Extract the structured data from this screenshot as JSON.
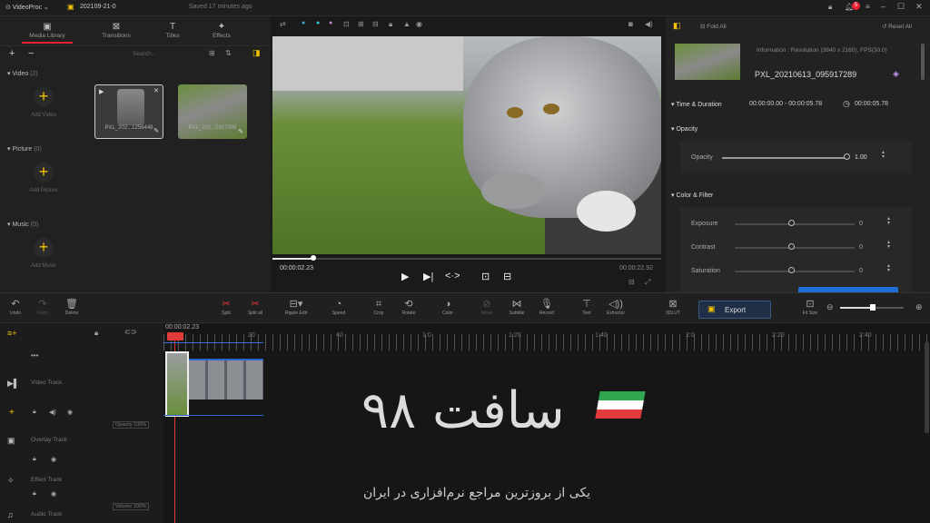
{
  "app": {
    "name": "VideoProc",
    "project": "202109-21-0",
    "saved": "Saved 17 minutes ago",
    "notif_count": "5"
  },
  "left_tabs": [
    {
      "label": "Media Library",
      "icon": "media-icon"
    },
    {
      "label": "Transitions",
      "icon": "transitions-icon"
    },
    {
      "label": "Titles",
      "icon": "titles-icon"
    },
    {
      "label": "Effects",
      "icon": "effects-icon"
    }
  ],
  "search": {
    "placeholder": "Search..."
  },
  "video_section": {
    "title": "Video",
    "count": "(2)",
    "add_label": "Add Video",
    "items": [
      {
        "name": "PXL_202...1256448"
      },
      {
        "name": "PXL_202...5917289"
      }
    ]
  },
  "picture_section": {
    "title": "Picture",
    "count": "(0)",
    "add_label": "Add Picture"
  },
  "music_section": {
    "title": "Music",
    "count": "(0)",
    "add_label": "Add Music"
  },
  "preview": {
    "current_time": "00:00:02.23",
    "total_time": "00:00:22.92"
  },
  "right": {
    "fold_all": "Fold All",
    "reset_all": "Reset All",
    "info": "Information : Resolution (3840 x 2160), FPS(30.0)",
    "clip_name": "PXL_20210613_095917289",
    "time_duration": {
      "title": "Time & Duration",
      "range": "00:00:00.00 - 00:00:05.78",
      "duration": "00:00:05.78"
    },
    "opacity": {
      "title": "Opacity",
      "label": "Opacity",
      "value": "1.00",
      "level": 1.0
    },
    "color_filter": {
      "title": "Color & Filter",
      "rows": [
        {
          "label": "Exposure",
          "value": "0"
        },
        {
          "label": "Contrast",
          "value": "0"
        },
        {
          "label": "Saturation",
          "value": "0"
        }
      ]
    }
  },
  "toolbar": {
    "items": [
      "Undo",
      "Redo",
      "Delete",
      "Split",
      "Split all",
      "Ripple Edit",
      "Speed",
      "Crop",
      "Rotate",
      "Color",
      "Mask",
      "Subtitle",
      "Record",
      "Text",
      "Extractor",
      "3DLUT"
    ],
    "export": "Export",
    "fit_size": "Fit Size"
  },
  "timeline": {
    "playhead": "00:00:02.23",
    "ticks": [
      "20",
      "40",
      "1:0",
      "1:20",
      "1:40",
      "2:0",
      "2:20",
      "2:40"
    ],
    "tracks": [
      {
        "label": "Video Track"
      },
      {
        "label": "Overlay Track"
      },
      {
        "label": "Effect Track"
      },
      {
        "label": "Audio Track"
      }
    ],
    "opacity_label": "Opacity 100%",
    "volume_label": "Volume 100%"
  },
  "watermark": {
    "logo_text": "سافت ۹۸",
    "tagline": "یکی از بروزترین مراجع نرم‌افزاری در ایران"
  },
  "colors": {
    "accent": "#f2c200",
    "export_bg": "#1f2f48",
    "playhead": "#e03b3b"
  }
}
